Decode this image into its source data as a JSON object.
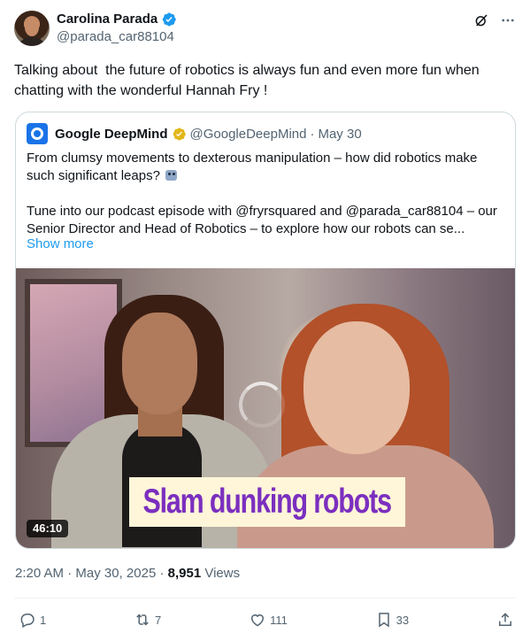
{
  "author": {
    "name": "Carolina Parada",
    "handle": "@parada_car88104",
    "verified_color": "#1d9bf0"
  },
  "tweet": {
    "text": "Talking about  the future of robotics is always fun and even more fun when chatting with the wonderful Hannah Fry !"
  },
  "quote": {
    "name": "Google DeepMind",
    "handle": "@GoogleDeepMind",
    "separator": "·",
    "date": "May 30",
    "badge_color": "#e2b719",
    "line1": "From clumsy movements to dexterous manipulation – how did robotics make such significant leaps?",
    "emoji": "robot-face",
    "line2": "Tune into our podcast episode with @fryrsquared and @parada_car88104 – our Senior Director and Head of Robotics – to explore how our robots can se...",
    "show_more": "Show more",
    "media": {
      "caption": "Slam dunking robots",
      "duration": "46:10"
    }
  },
  "meta": {
    "time": "2:20 AM",
    "separator": "·",
    "date": "May 30, 2025",
    "separator2": "·",
    "views_count": "8,951",
    "views_label": "Views"
  },
  "actions": {
    "replies": "1",
    "reposts": "7",
    "likes": "111",
    "bookmarks": "33"
  },
  "icons": {
    "top": [
      "grok-icon",
      "more-icon"
    ],
    "actions": [
      "reply-icon",
      "repost-icon",
      "like-icon",
      "bookmark-icon",
      "share-icon"
    ]
  },
  "colors": {
    "link": "#1d9bf0",
    "secondary_text": "#536471",
    "primary_text": "#0f1419",
    "caption_text": "#7b2fbf"
  }
}
